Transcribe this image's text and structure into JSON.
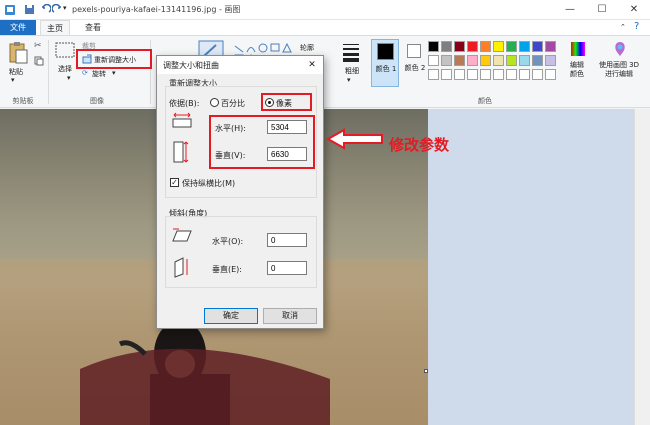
{
  "titlebar": {
    "title": "pexels-pouriya-kafaei-13141196.jpg - 画图",
    "minimize": "—",
    "maximize": "☐",
    "close": "✕"
  },
  "tabs": {
    "file": "文件",
    "home": "主页",
    "view": "查看"
  },
  "ribbon": {
    "clipboard": {
      "paste": "粘贴",
      "label": "剪贴板"
    },
    "image": {
      "select": "选择",
      "crop": "裁剪",
      "resize": "重新调整大小",
      "rotate": "旋转",
      "label": "图像"
    },
    "brushes": {
      "label": "刷子"
    },
    "shapes": {
      "outline": "轮廓",
      "fill": "填充"
    },
    "size": {
      "label": "粗细"
    },
    "color1": "颜色 1",
    "color2": "颜色 2",
    "edit_colors": "编辑颜色",
    "paint3d": "使用画图 3D 进行编辑",
    "colors_label": "颜色",
    "palette_row1": [
      "#000000",
      "#7f7f7f",
      "#880015",
      "#ed1c24",
      "#ff7f27",
      "#fff200",
      "#22b14c",
      "#00a2e8",
      "#3f48cc",
      "#a349a4"
    ],
    "palette_row2": [
      "#ffffff",
      "#c3c3c3",
      "#b97a57",
      "#ffaec9",
      "#ffc90e",
      "#efe4b0",
      "#b5e61d",
      "#99d9ea",
      "#7092be",
      "#c8bfe7"
    ]
  },
  "dialog": {
    "title": "调整大小和扭曲",
    "close": "✕",
    "resize_group": "重新调整大小",
    "by_label": "依据(B):",
    "percent": "百分比",
    "pixels": "像素",
    "horizontal_label": "水平(H):",
    "horizontal_value": "5304",
    "vertical_label": "垂直(V):",
    "vertical_value": "6630",
    "keep_ratio": "保持纵横比(M)",
    "skew_group": "倾斜(角度)",
    "skew_h_label": "水平(O):",
    "skew_h_value": "0",
    "skew_v_label": "垂直(E):",
    "skew_v_value": "0",
    "ok": "确定",
    "cancel": "取消"
  },
  "annotation": "修改参数",
  "colors": {
    "annotation_red": "#e51b24",
    "file_tab_blue": "#1e6fc4"
  }
}
